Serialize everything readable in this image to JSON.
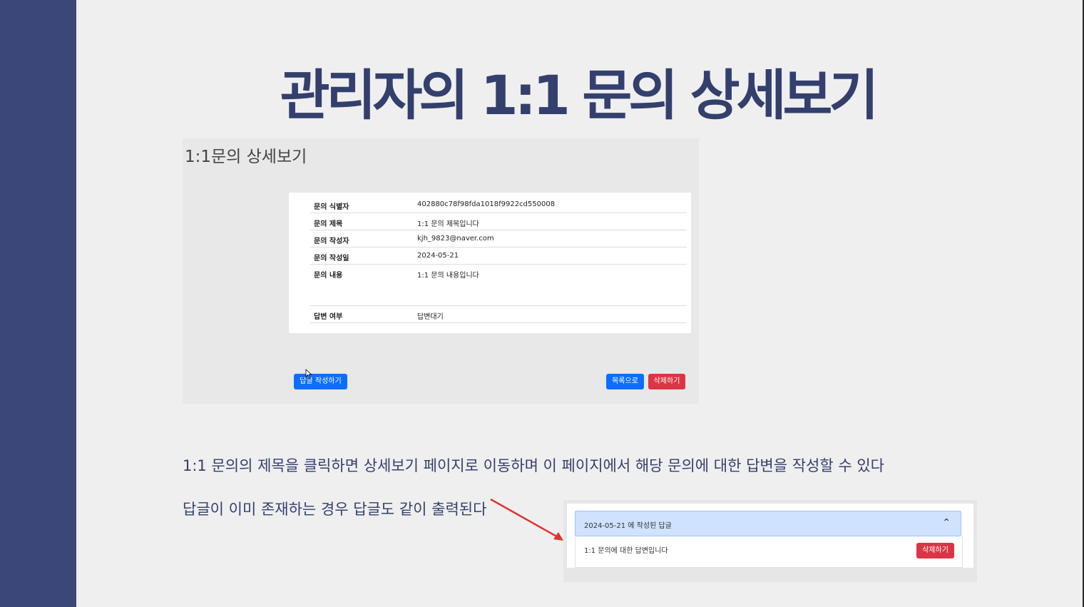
{
  "slide": {
    "title": "관리자의 1:1 문의 상세보기"
  },
  "screenshot": {
    "page_title": "1:1문의 상세보기",
    "rows": [
      {
        "label": "문의 식별자",
        "value": "402880c78f98fda1018f9922cd550008"
      },
      {
        "label": "문의 제목",
        "value": "1:1 문의 제목입니다"
      },
      {
        "label": "문의 작성자",
        "value": "kjh_9823@naver.com"
      },
      {
        "label": "문의 작성일",
        "value": "2024-05-21"
      },
      {
        "label": "문의 내용",
        "value": "1:1 문의 내용입니다"
      },
      {
        "label": "답변 여부",
        "value": "답변대기"
      }
    ],
    "buttons": {
      "write_reply": "답글 작성하기",
      "list": "목록으로",
      "delete": "삭제하기"
    }
  },
  "descriptions": {
    "line1": "1:1 문의의 제목을 클릭하면 상세보기 페이지로 이동하며 이 페이지에서 해당 문의에 대한 답변을 작성할 수 있다",
    "line2": "답글이 이미 존재하는 경우 답글도 같이 출력된다"
  },
  "reply_panel": {
    "header": "2024-05-21 에 작성된 답글",
    "body": "1:1 문의에 대한 답변입니다",
    "delete_button": "삭제하기",
    "chevron_icon": "chevron-up-icon"
  },
  "colors": {
    "sidebar": "#3a4778",
    "title": "#33406e",
    "primary": "#0d6efd",
    "danger": "#dc3545",
    "accordion_header": "#cfe2ff",
    "arrow": "#e0342c"
  }
}
